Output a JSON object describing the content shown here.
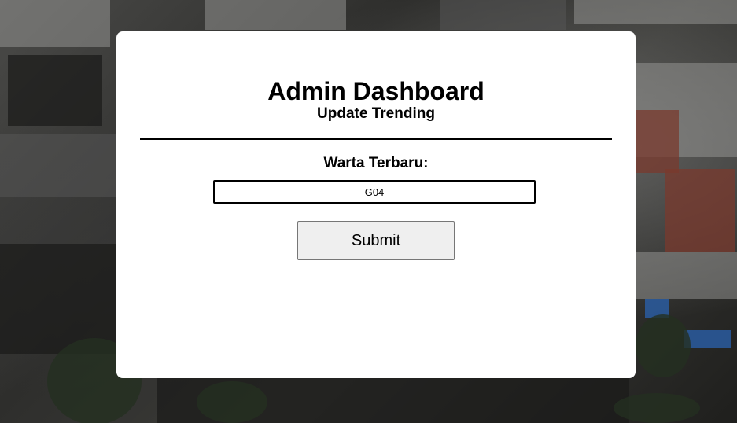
{
  "header": {
    "title": "Admin Dashboard",
    "subtitle": "Update Trending"
  },
  "form": {
    "field_label": "Warta Terbaru:",
    "field_value": "G04",
    "submit_label": "Submit"
  }
}
